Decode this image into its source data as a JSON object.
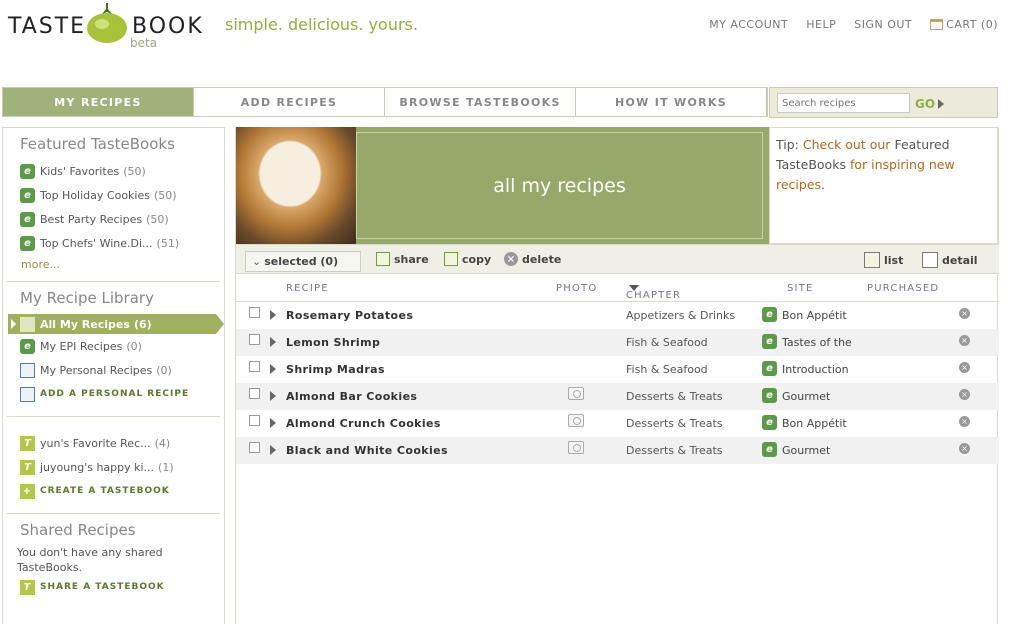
{
  "header": {
    "logo_left": "TASTE",
    "logo_right": "BOOK",
    "logo_beta": "beta",
    "tagline": "simple. delicious. yours.",
    "links": {
      "account": "MY ACCOUNT",
      "help": "HELP",
      "signout": "SIGN OUT",
      "cart": "CART (0)"
    }
  },
  "nav": {
    "tabs": [
      "MY RECIPES",
      "ADD RECIPES",
      "BROWSE TASTEBOOKS",
      "HOW IT WORKS"
    ],
    "active_index": 0,
    "search_placeholder": "Search recipes",
    "go_label": "GO"
  },
  "sidebar": {
    "featured_title": "Featured TasteBooks",
    "featured": [
      {
        "label": "Kids' Favorites",
        "count": "(50)"
      },
      {
        "label": "Top Holiday Cookies",
        "count": "(50)"
      },
      {
        "label": "Best Party Recipes",
        "count": "(50)"
      },
      {
        "label": "Top Chefs' Wine.Di...",
        "count": "(51)"
      }
    ],
    "more": "more...",
    "library_title": "My Recipe Library",
    "library": [
      {
        "label": "All My Recipes",
        "count": "(6)"
      },
      {
        "label": "My EPI Recipes",
        "count": "(0)"
      },
      {
        "label": "My Personal Recipes",
        "count": "(0)"
      }
    ],
    "add_personal": "ADD A PERSONAL RECIPE",
    "tastebooks": [
      {
        "label": "yun's Favorite Rec...",
        "count": "(4)"
      },
      {
        "label": "juyoung's happy ki...",
        "count": "(1)"
      }
    ],
    "create_tastebook": "CREATE A TASTEBOOK",
    "shared_title": "Shared Recipes",
    "shared_note": "You don't have any shared TasteBooks.",
    "share_tastebook": "SHARE A TASTEBOOK"
  },
  "banner": {
    "title": "all my recipes",
    "tip_prefix": "Tip:",
    "tip_link1": "Check out our",
    "tip_middle": "Featured TasteBooks",
    "tip_link2": "for inspiring new recipes",
    "tip_end": "."
  },
  "toolbar": {
    "selected": "selected (0)",
    "share": "share",
    "copy": "copy",
    "delete": "delete",
    "list": "list",
    "detail": "detail"
  },
  "table": {
    "headers": {
      "recipe": "RECIPE",
      "photo": "PHOTO",
      "chapter": "CHAPTER",
      "site": "SITE",
      "purchased": "PURCHASED"
    },
    "rows": [
      {
        "name": "Rosemary Potatoes",
        "photo": false,
        "chapter": "Appetizers & Drinks",
        "site": "Bon Appétit"
      },
      {
        "name": "Lemon Shrimp",
        "photo": false,
        "chapter": "Fish & Seafood",
        "site": "Tastes of the"
      },
      {
        "name": "Shrimp Madras",
        "photo": false,
        "chapter": "Fish & Seafood",
        "site": "Introduction"
      },
      {
        "name": "Almond Bar Cookies",
        "photo": true,
        "chapter": "Desserts & Treats",
        "site": "Gourmet"
      },
      {
        "name": "Almond Crunch Cookies",
        "photo": true,
        "chapter": "Desserts & Treats",
        "site": "Bon Appétit"
      },
      {
        "name": "Black and White Cookies",
        "photo": true,
        "chapter": "Desserts & Treats",
        "site": "Gourmet"
      }
    ]
  },
  "colors": {
    "accent_green": "#9fb27a",
    "link_orange": "#b36a1d",
    "tagline_green": "#8eb040"
  }
}
